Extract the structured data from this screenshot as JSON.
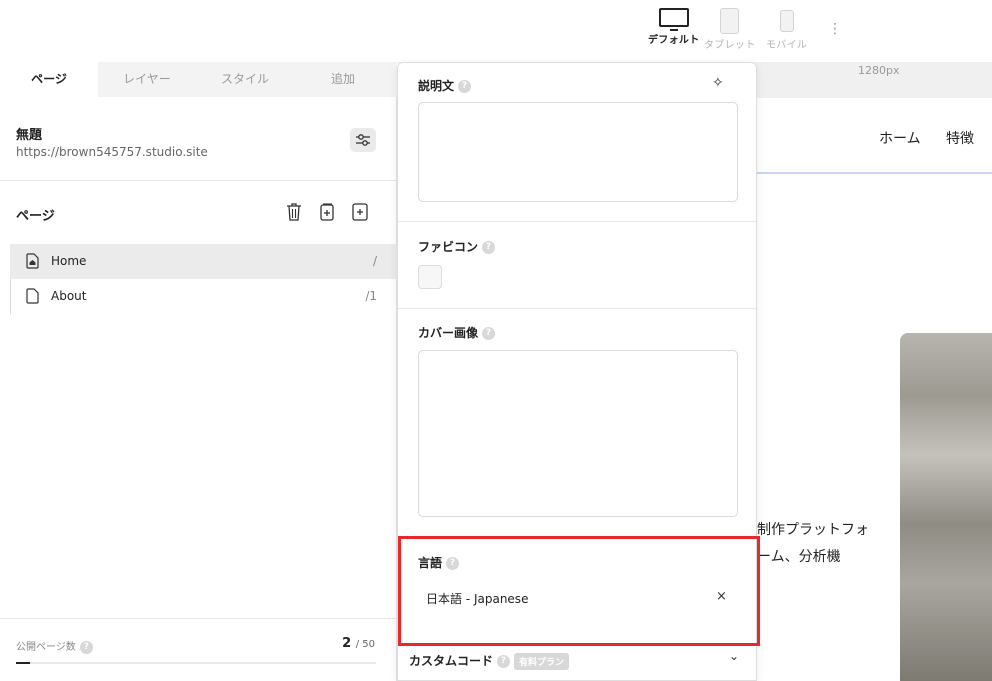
{
  "devices": [
    {
      "label": "デフォルト",
      "state": "active"
    },
    {
      "label": "タブレット",
      "state": "inactive"
    },
    {
      "label": "モバイル",
      "state": "inactive"
    }
  ],
  "canvas": {
    "width_label": "1280px",
    "nav": [
      "ホーム",
      "特徴"
    ],
    "text_lines": [
      "制作プラットフォ",
      "ーム、分析機"
    ]
  },
  "left_panel": {
    "tabs": [
      "ページ",
      "レイヤー",
      "スタイル",
      "追加"
    ],
    "active_tab": 0,
    "site": {
      "title": "無題",
      "url": "https://brown545757.studio.site"
    },
    "pages_header": "ページ",
    "pages": [
      {
        "name": "Home",
        "path": "/",
        "selected": true,
        "icon": "home-page-icon"
      },
      {
        "name": "About",
        "path": "/1",
        "selected": false,
        "icon": "page-icon"
      }
    ],
    "footer": {
      "label": "公開ページ数",
      "count": "2",
      "total": "/ 50",
      "progress_fraction": 0.04
    }
  },
  "settings_panel": {
    "description_label": "説明文",
    "favicon_label": "ファビコン",
    "cover_label": "カバー画像",
    "language_label": "言語",
    "language_value": "日本語 - Japanese",
    "clear_symbol": "×",
    "custom_code_label": "カスタムコード",
    "paid_badge": "有料プラン",
    "help_symbol": "?"
  },
  "colors": {
    "highlight": "#e8282d",
    "accent_line": "#c8d6f5"
  }
}
